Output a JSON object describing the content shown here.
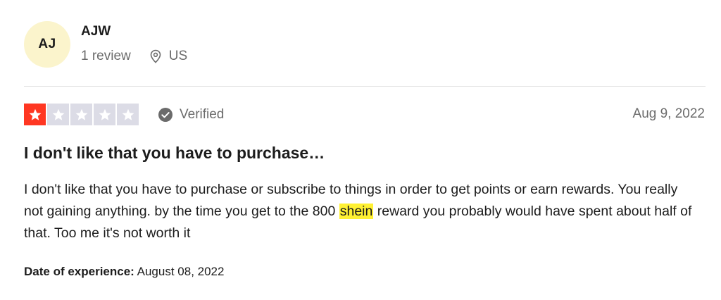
{
  "consumer": {
    "initials": "AJ",
    "name": "AJW",
    "review_count": "1 review",
    "location_icon": "location-pin-icon",
    "country": "US"
  },
  "review": {
    "rating": 1,
    "rating_max": 5,
    "star_color": "#ff3722",
    "star_empty_color": "#dcdce6",
    "verified_label": "Verified",
    "date": "Aug 9, 2022",
    "title": "I don't like that you have to purchase…",
    "body_before": "I don't like that you have to purchase or subscribe to things in order to get points or earn rewards. You really not gaining anything. by the time you get to the 800 ",
    "body_highlight": "shein",
    "body_after": " reward you probably would have spent about half of that. Too me it's not worth it",
    "highlight_color": "#fff133",
    "experience_label": "Date of experience:",
    "experience_date": "August 08, 2022"
  }
}
